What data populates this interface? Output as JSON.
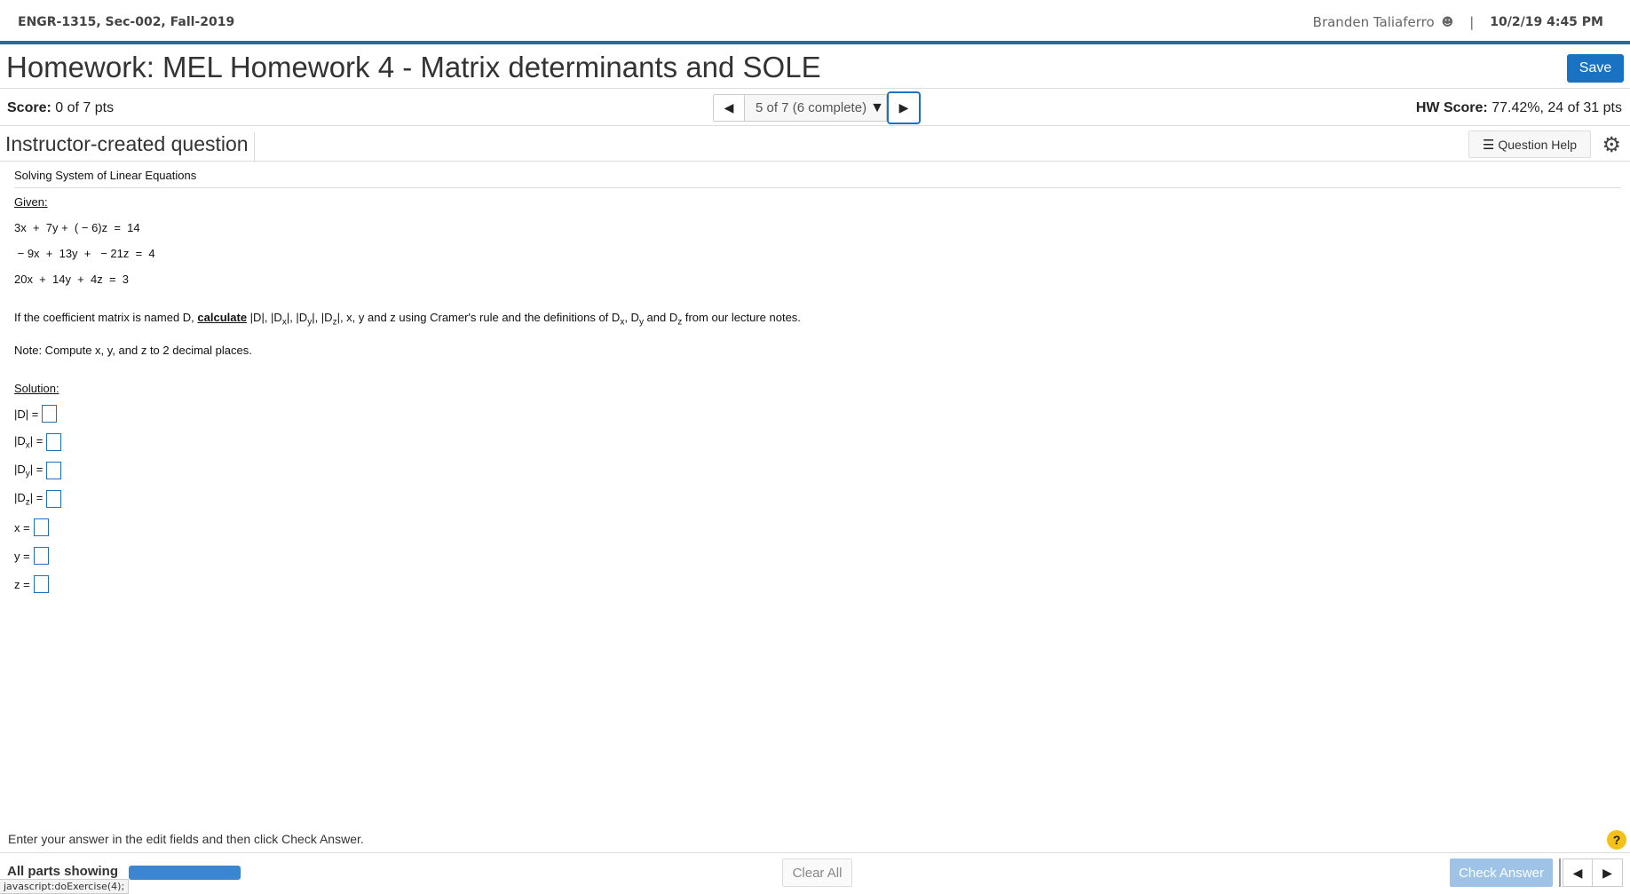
{
  "header": {
    "course": "ENGR-1315, Sec-002, Fall-2019",
    "user_name": "Branden Taliaferro",
    "user_icon": "user-icon",
    "separator": "|",
    "datetime": "10/2/19 4:45 PM"
  },
  "title_row": {
    "page_title": "Homework: MEL Homework 4 - Matrix determinants and SOLE",
    "save_label": "Save"
  },
  "score_row": {
    "score_label": "Score:",
    "score_value": "0 of 7 pts",
    "question_selector": "5 of 7 (6 complete)",
    "hw_score_label": "HW Score:",
    "hw_score_value": "77.42%, 24 of 31 pts"
  },
  "question_header": {
    "title": "Instructor-created question",
    "help_label": "Question Help"
  },
  "question": {
    "problem_title": "Solving System of Linear Equations",
    "given_label": "Given:",
    "equations": [
      "3x  +  7y +  ( − 6)z  =  14",
      " − 9x  +  13y  +   − 21z  =  4",
      "20x  +  14y  +  4z  =  3"
    ],
    "instruction": {
      "prefix": "If the coefficient matrix is named D, ",
      "calculate": "calculate",
      "d_abs": " |D|, |D",
      "x": "x",
      "mid1": "|, |D",
      "y": "y",
      "mid2": "|, |D",
      "z": "z",
      "mid3": "|, x, y and z using Cramer's rule and the definitions of D",
      "x2": "x",
      "comma": ", D",
      "y2": "y",
      "and": " and D",
      "z2": "z",
      "suffix": " from our lecture notes."
    },
    "note": "Note:  Compute x, y, and z to 2 decimal places.",
    "solution_label": "Solution:",
    "answers": {
      "d": "|D| =",
      "dx_pre": "|D",
      "dx_sub": "x",
      "dy_pre": "|D",
      "dy_sub": "y",
      "dz_pre": "|D",
      "dz_sub": "z",
      "abs_eq": "| =",
      "x": "x =",
      "y": "y =",
      "z": "z ="
    }
  },
  "footer": {
    "instruction": "Enter your answer in the edit fields and then click Check Answer.",
    "help_symbol": "?",
    "parts_label": "All parts showing",
    "status_url": "javascript:doExercise(4);",
    "clear_all_label": "Clear All",
    "check_answer_label": "Check Answer"
  }
}
